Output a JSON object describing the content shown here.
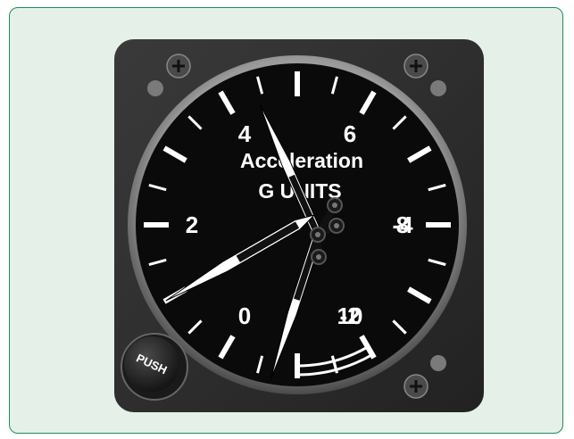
{
  "gauge": {
    "title_line1": "Acceleration",
    "title_line2": "G UNITS",
    "scale_labels": [
      "-4",
      "-2",
      "0",
      "2",
      "4",
      "6",
      "8",
      "10"
    ],
    "scale_min": -5,
    "scale_max": 11,
    "pointer_main_value": 1,
    "pointer_max_value": 4.2,
    "pointer_min_value": -0.4,
    "redline_from_value": 10,
    "redline_to_value": 11,
    "reset_button_label": "PUSH"
  },
  "colors": {
    "background": "#e5f1e8",
    "border": "#1f8a5a",
    "case": "#2e2e2e",
    "dial": "#0a0a0a",
    "markings": "#ffffff"
  }
}
